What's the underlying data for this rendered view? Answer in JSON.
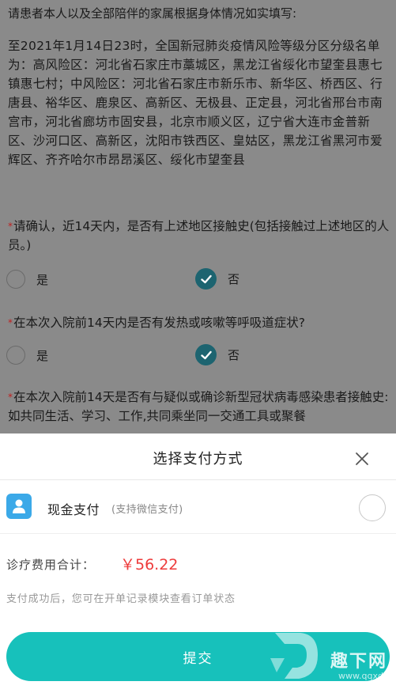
{
  "form": {
    "intro": "请患者本人以及全部陪伴的家属根据身体情况如实填写:",
    "notice": "至2021年1月14日23时，全国新冠肺炎疫情风险等级分区分级名单为：高风险区：河北省石家庄市藁城区，黑龙江省绥化市望奎县惠七镇惠七村；中风险区：河北省石家庄市新乐市、新华区、桥西区、行唐县、裕华区、鹿泉区、高新区、无极县、正定县，河北省邢台市南宫市，河北省廊坊市固安县，北京市顺义区，辽宁省大连市金普新区、沙河口区、高新区，沈阳市铁西区、皇姑区，黑龙江省黑河市爱辉区、齐齐哈尔市昂昂溪区、绥化市望奎县",
    "required_mark": "*",
    "q1": "请确认，近14天内，是否有上述地区接触史(包括接触过上述地区的人员。)",
    "q2": "在本次入院前14天内是否有发热或咳嗽等呼吸道症状?",
    "q3": "在本次入院前14天是否有与疑似或确诊新型冠状病毒感染患者接触史:如共同生活、学习、工作,共同乘坐同一交通工具或聚餐",
    "yes": "是",
    "no": "否"
  },
  "sheet": {
    "title": "选择支付方式",
    "pay_method": "现金支付",
    "pay_method_note": "(支持微信支付)",
    "fee_label": "诊疗费用合计：",
    "fee_amount": "￥56.22",
    "hint": "支付成功后，您可在开单记录模块查看订单状态",
    "submit": "提交"
  },
  "watermark": {
    "text": "趣下网",
    "url": "www.qqxd.com"
  },
  "colors": {
    "accent": "#17c1bb",
    "price": "#ee3b3b",
    "checked": "#1d6470",
    "wallet": "#3ba9e8"
  },
  "icons": [
    "check-icon",
    "close-icon",
    "wallet-icon"
  ]
}
